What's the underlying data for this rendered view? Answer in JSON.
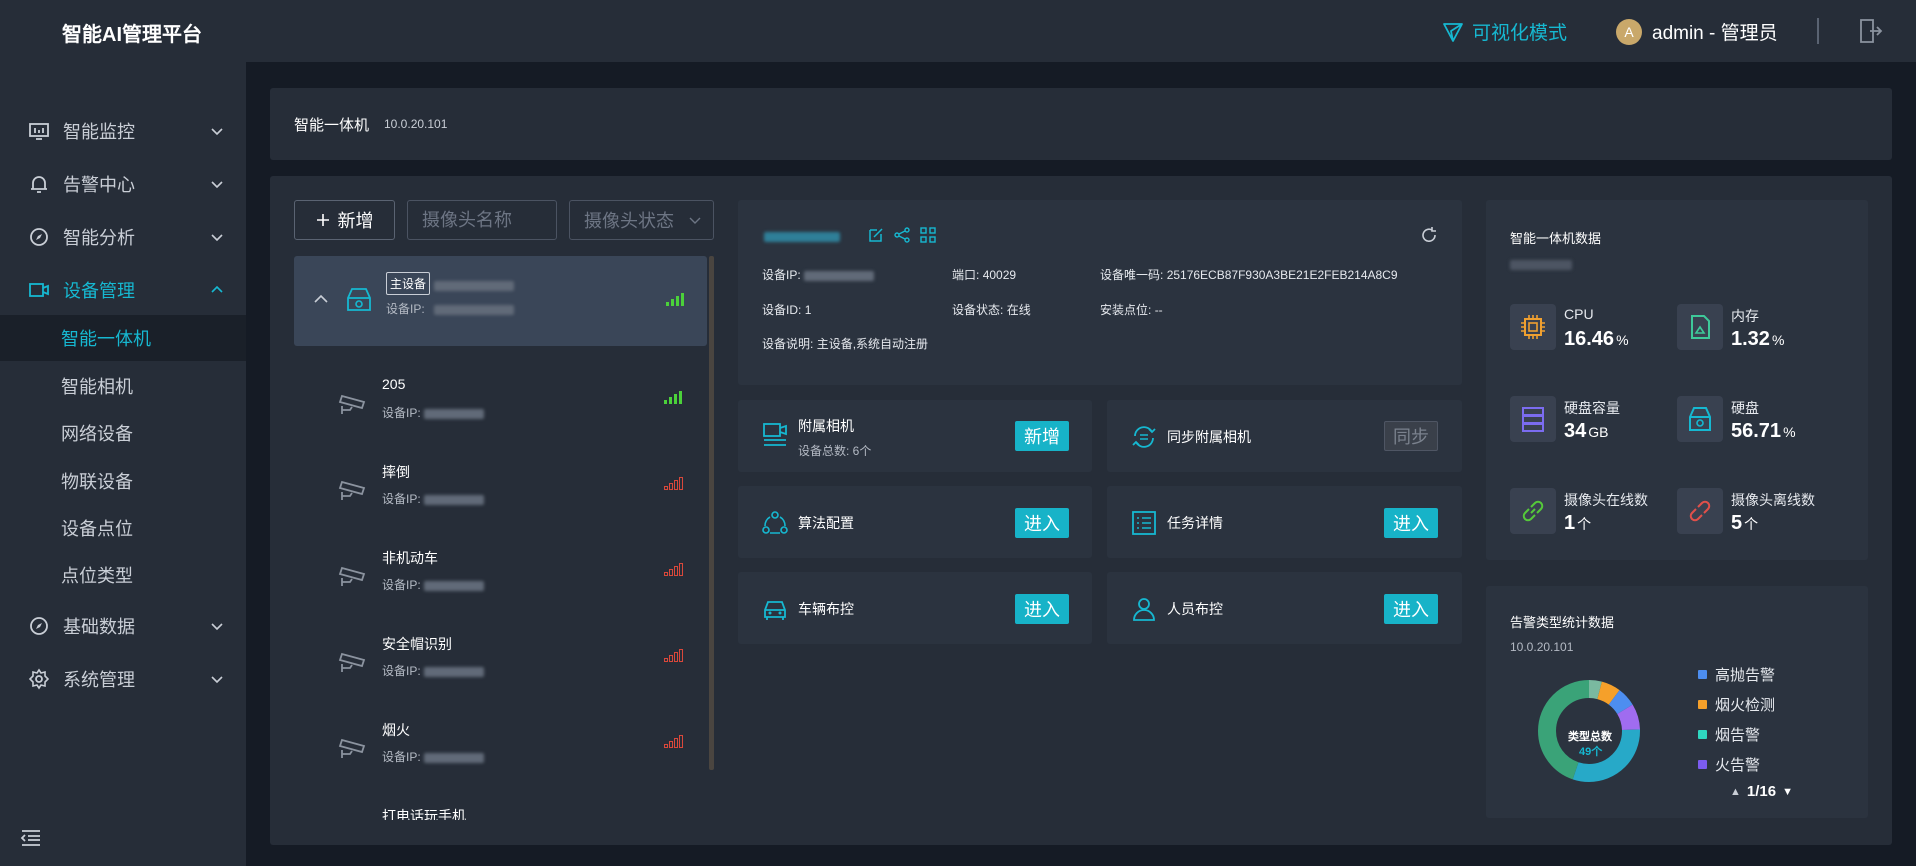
{
  "app": {
    "title": "智能AI管理平台"
  },
  "topbar": {
    "vis_mode": "可视化模式",
    "avatar_letter": "A",
    "user": "admin - 管理员"
  },
  "sidebar": {
    "menu": [
      {
        "label": "智能监控",
        "icon": "monitor-icon"
      },
      {
        "label": "告警中心",
        "icon": "bell-icon"
      },
      {
        "label": "智能分析",
        "icon": "compass-icon"
      },
      {
        "label": "设备管理",
        "icon": "camera-device-icon"
      },
      {
        "label": "基础数据",
        "icon": "compass-icon"
      },
      {
        "label": "系统管理",
        "icon": "gear-icon"
      }
    ],
    "submenu": [
      "智能一体机",
      "智能相机",
      "网络设备",
      "物联设备",
      "设备点位",
      "点位类型"
    ]
  },
  "header": {
    "title": "智能一体机",
    "ip": "10.0.20.101"
  },
  "list": {
    "add_label": "新增",
    "search_placeholder": "摄像头名称",
    "status_placeholder": "摄像头状态",
    "main_badge": "主设备",
    "main_ip_label": "设备IP:",
    "ip_label": "设备IP:",
    "cameras": [
      {
        "name": "205",
        "online": true
      },
      {
        "name": "摔倒",
        "online": false
      },
      {
        "name": "非机动车",
        "online": false
      },
      {
        "name": "安全帽识别",
        "online": false
      },
      {
        "name": "烟火",
        "online": false
      },
      {
        "name": "打电话玩手机",
        "online": false
      }
    ]
  },
  "device": {
    "ip_label": "设备IP:",
    "port_label": "端口:",
    "port": "40029",
    "uid_label": "设备唯一码:",
    "uid": "25176ECB87F930A3BE21E2FEB214A8C9",
    "id_label": "设备ID:",
    "id": "1",
    "status_label": "设备状态:",
    "status": "在线",
    "location_label": "安装点位:",
    "location": "--",
    "desc_label": "设备说明:",
    "desc": "主设备,系统自动注册"
  },
  "actions": {
    "cameras_title": "附属相机",
    "cameras_count": "设备总数: 6个",
    "add_btn": "新增",
    "sync_title": "同步附属相机",
    "sync_btn": "同步",
    "algo_title": "算法配置",
    "task_title": "任务详情",
    "vehicle_title": "车辆布控",
    "person_title": "人员布控",
    "enter_btn": "进入"
  },
  "stats": {
    "title": "智能一体机数据",
    "cpu_label": "CPU",
    "cpu_value": "16.46",
    "pct": "%",
    "mem_label": "内存",
    "mem_value": "1.32",
    "disk_cap_label": "硬盘容量",
    "disk_cap_value": "34",
    "gb": "GB",
    "disk_label": "硬盘",
    "disk_value": "56.71",
    "online_label": "摄像头在线数",
    "online_value": "1",
    "unit_ge": "个",
    "offline_label": "摄像头离线数",
    "offline_value": "5"
  },
  "alarm": {
    "title": "告警类型统计数据",
    "ip": "10.0.20.101",
    "center_label": "类型总数",
    "center_value": "49个",
    "legend": [
      "高抛告警",
      "烟火检测",
      "烟告警",
      "火告警"
    ],
    "legend_colors": [
      "#4d8ef0",
      "#f5a02a",
      "#2fd7c0",
      "#7c5cf0"
    ],
    "pager": "1/16"
  },
  "chart_data": {
    "type": "pie",
    "slices": [
      {
        "name": "",
        "value": 2,
        "color": "#7ab9a0"
      },
      {
        "name": "",
        "value": 3,
        "color": "#f5a02a"
      },
      {
        "name": "",
        "value": 3,
        "color": "#4d8ef0"
      },
      {
        "name": "",
        "value": 4,
        "color": "#a06cf0"
      },
      {
        "name": "",
        "value": 15,
        "color": "#27a9c8"
      },
      {
        "name": "",
        "value": 22,
        "color": "#3aa378"
      }
    ]
  }
}
